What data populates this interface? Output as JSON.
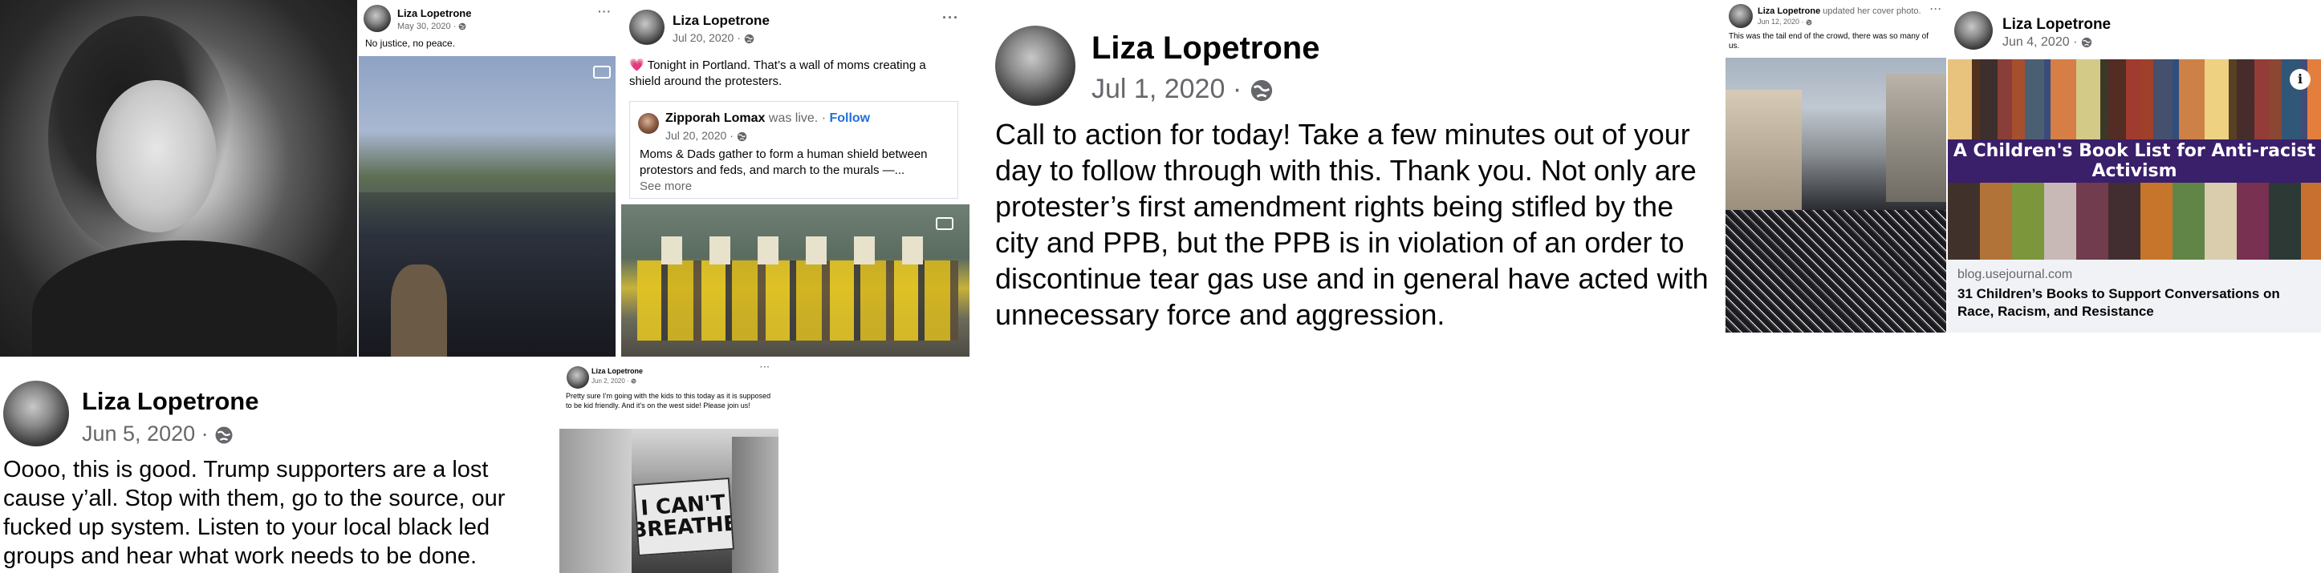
{
  "common": {
    "author": "Liza Lopetrone",
    "more": "···",
    "sep": "·"
  },
  "post_justice": {
    "date": "May 30, 2020",
    "text": "No justice, no peace."
  },
  "post_portland": {
    "date": "Jul 20, 2020",
    "text": "💗 Tonight in Portland. That’s a wall of moms creating a shield around the protesters.",
    "shared": {
      "author": "Zipporah Lomax",
      "action": " was live. · ",
      "follow": "Follow",
      "date": "Jul 20, 2020",
      "text": "Moms & Dads gather to form a human shield between protestors and feds, and march to the murals —... ",
      "see_more": "See more"
    }
  },
  "post_call": {
    "date": "Jul 1, 2020",
    "text": "Call to action for today! Take a few minutes out of your day to follow through with this. Thank you. Not only are protester’s first amendment rights being stifled by the city and PPB, but the PPB is in violation of an order to discontinue tear gas use and in general have acted with unnecessary force and aggression."
  },
  "post_cover": {
    "action": " updated her cover photo.",
    "date": "Jun 12, 2020",
    "text": "This was the tail end of the crowd, there was so many of us."
  },
  "post_books": {
    "date": "Jun 4, 2020",
    "banner": "A Children's Book List for Anti-racist Activism",
    "link_domain": "blog.usejournal.com",
    "link_title": "31 Children’s Books to Support Conversations on Race, Racism, and Resistance",
    "info": "i"
  },
  "post_trump": {
    "date": "Jun 5, 2020",
    "text": "Oooo, this is good. Trump supporters are a lost cause y’all. Stop with them, go to the source, our fucked up system. Listen to your local black led groups and hear what work needs to be done."
  },
  "post_kids": {
    "date": "Jun 2, 2020",
    "text": "Pretty sure I’m going with the kids to this today as it is supposed to be kid friendly. And it’s on the west side! Please join us!",
    "sign": "I CAN'T BREATHE"
  }
}
